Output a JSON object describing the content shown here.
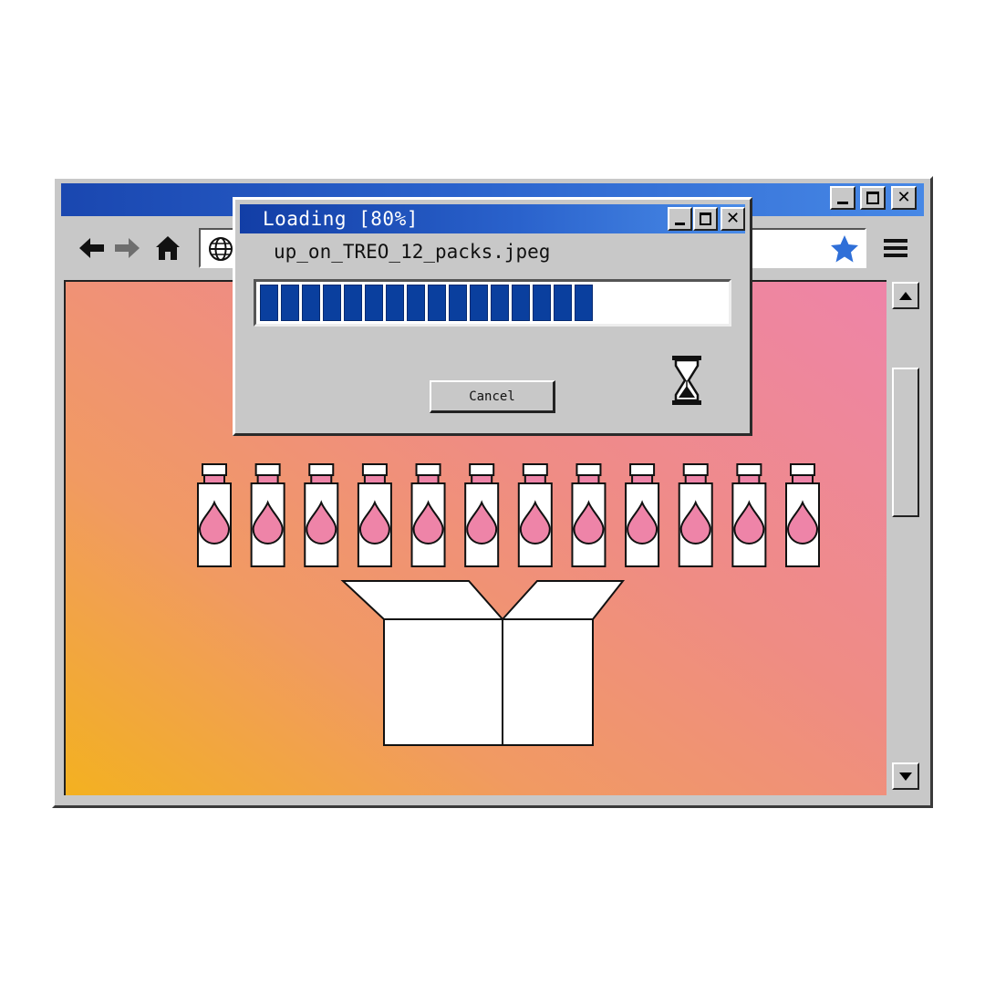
{
  "browser": {
    "window_controls": [
      "minimize-icon",
      "maximize-icon",
      "close-icon"
    ],
    "toolbar": {
      "icons": [
        "back-arrow-icon",
        "forward-arrow-icon",
        "home-icon",
        "globe-icon",
        "star-icon",
        "menu-icon"
      ]
    },
    "colors": {
      "titlebar_start": "#1a47b0",
      "titlebar_end": "#4788e6",
      "star": "#2f6fd8"
    }
  },
  "dialog": {
    "title": "Loading [80%]",
    "filename": "up_on_TREO_12_packs.jpeg",
    "progress_fraction": 0.8,
    "progress_blocks": 16,
    "cancel_label": "Cancel",
    "icon": "hourglass-icon",
    "window_controls": [
      "minimize-icon",
      "maximize-icon",
      "close-icon"
    ]
  },
  "content": {
    "illustration": {
      "bottle_count": 12,
      "items": "bottle-icon",
      "box": "open-box-icon",
      "colors": {
        "bottle": "#ffffff",
        "cap": "#ee84a8",
        "drop": "#ee84a8",
        "outline": "#111111"
      }
    },
    "background_colors": [
      "#f3b120",
      "#f19a62",
      "#ef8c84",
      "#ee84a8"
    ]
  }
}
